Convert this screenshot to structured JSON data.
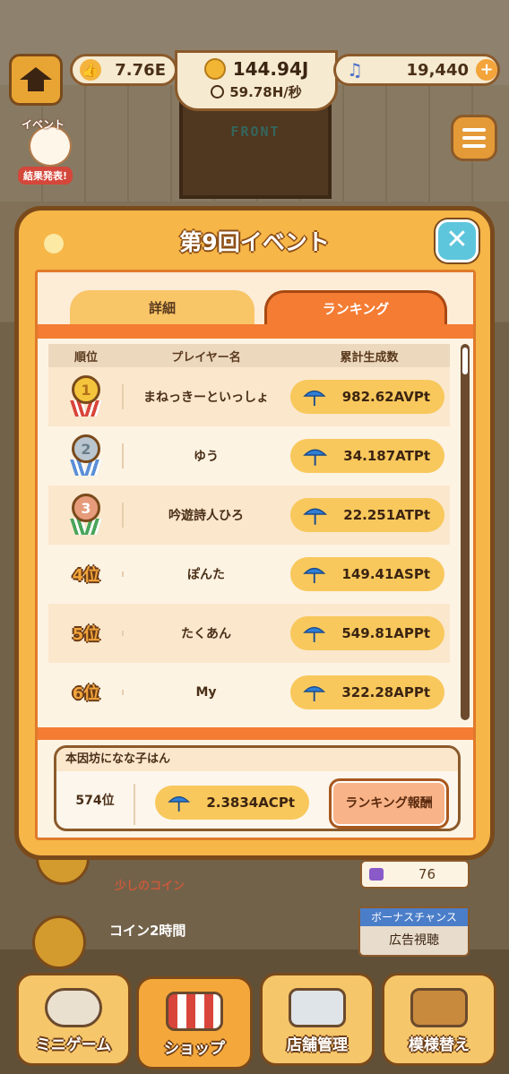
{
  "hud": {
    "likes": "7.76E",
    "money": "144.94J",
    "rate": "59.78H/秒",
    "gems": "19,440"
  },
  "front_sign": "FRONT",
  "event_badge": {
    "title": "イベント",
    "result": "結果発表!"
  },
  "modal": {
    "title": "第9回イベント",
    "close_label": "✕",
    "tabs": [
      {
        "label": "詳細",
        "active": false
      },
      {
        "label": "ランキング",
        "active": true
      }
    ],
    "columns": [
      "順位",
      "プレイヤー名",
      "累計生成数"
    ],
    "rows": [
      {
        "rank": "1",
        "name": "まねっきーといっしょ",
        "score": "982.62AV",
        "unit": "Pt"
      },
      {
        "rank": "2",
        "name": "ゆう",
        "score": "34.187AT",
        "unit": "Pt"
      },
      {
        "rank": "3",
        "name": "吟遊詩人ひろ",
        "score": "22.251AT",
        "unit": "Pt"
      },
      {
        "rank": "4位",
        "name": "ぽんた",
        "score": "149.41AS",
        "unit": "Pt"
      },
      {
        "rank": "5位",
        "name": "たくあん",
        "score": "549.81AP",
        "unit": "Pt"
      },
      {
        "rank": "6位",
        "name": "My",
        "score": "322.28AP",
        "unit": "Pt"
      }
    ],
    "me": {
      "name": "本因坊になな子はん",
      "rank": "574位",
      "score": "2.3834AC",
      "unit": "Pt",
      "reward_button": "ランキング報酬"
    }
  },
  "below": {
    "item1_label": "少しのコイン",
    "item2_label": "コイン2時間",
    "side_count": "76",
    "bonus_title": "ボーナスチャンス",
    "bonus_action": "広告視聴"
  },
  "nav": [
    {
      "label": "ミニゲーム"
    },
    {
      "label": "ショップ"
    },
    {
      "label": "店舗管理"
    },
    {
      "label": "模様替え"
    }
  ],
  "colors": {
    "accent_orange": "#f47c33",
    "modal_bg": "#f6b648",
    "close_button": "#5dc6dc",
    "score_pill": "#f8c85c",
    "umbrella": "#2f7fd6"
  }
}
